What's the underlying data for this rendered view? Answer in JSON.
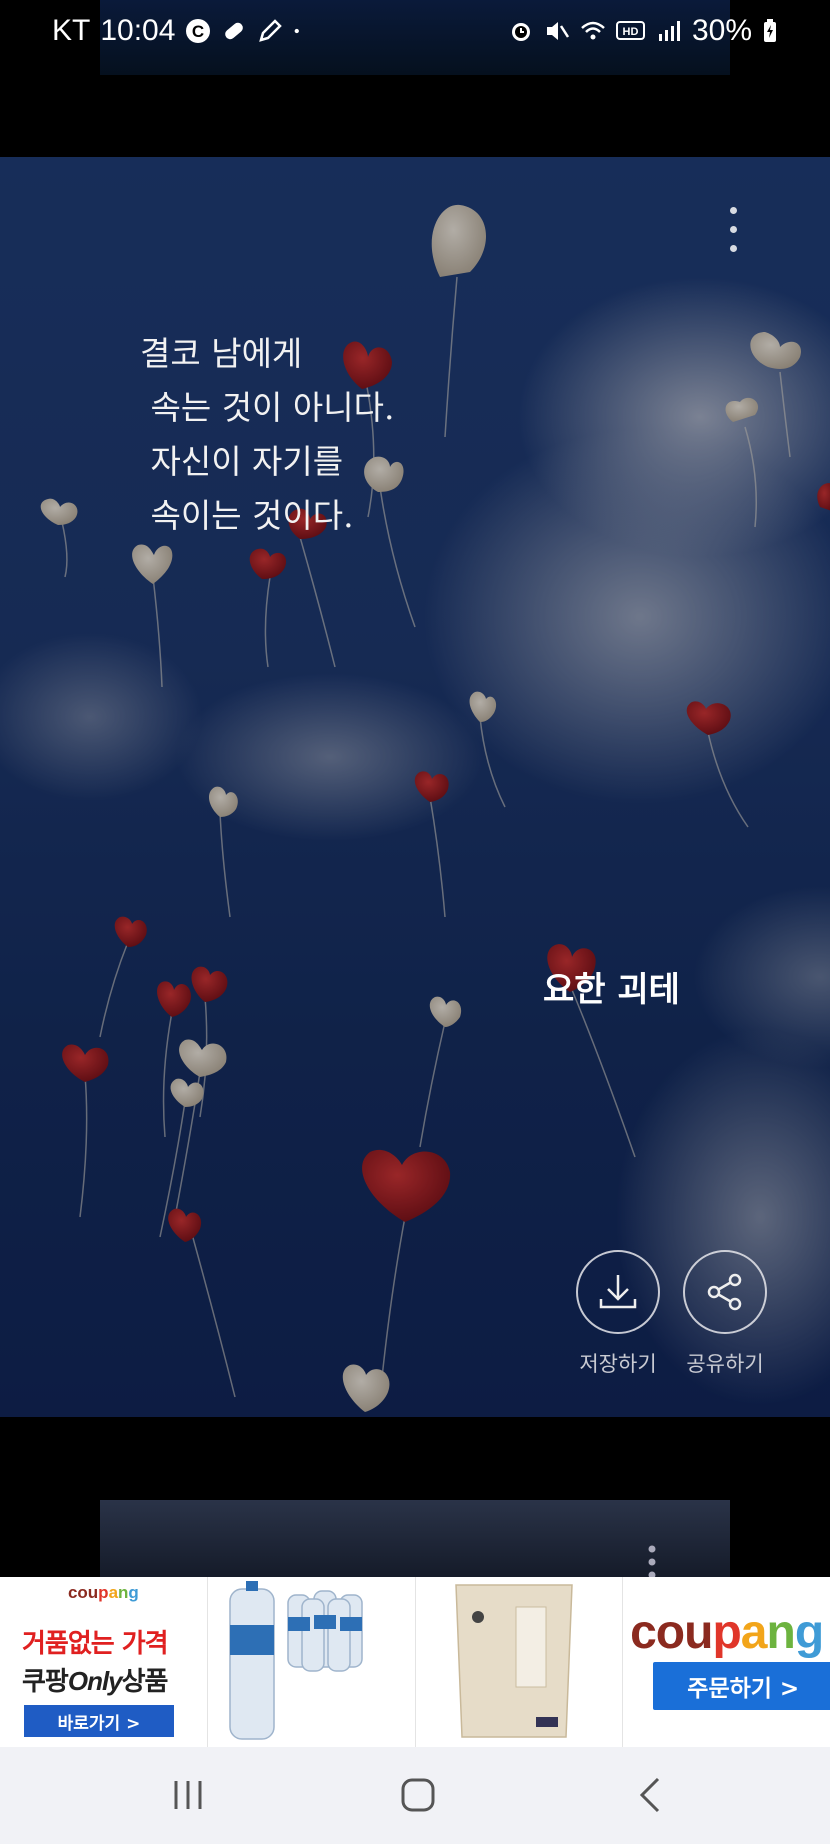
{
  "status_bar": {
    "carrier": "KT",
    "time": "10:04",
    "battery": "30%",
    "left_icons": [
      "c-circle-icon",
      "pill-icon",
      "pen-icon",
      "dot-icon"
    ],
    "right_icons": [
      "alarm-icon",
      "mute-icon",
      "wifi-icon",
      "hd-icon",
      "signal-icon",
      "battery-icon"
    ]
  },
  "card": {
    "quote_lines": [
      "결코 남에게",
      " 속는 것이 아니다.",
      " 자신이 자기를",
      " 속이는 것이다."
    ],
    "author": "요한 괴테",
    "actions": {
      "save_label": "저장하기",
      "share_label": "공유하기"
    },
    "background_icon": "balloons-sky-image"
  },
  "ad_banner": {
    "brand": "coupang",
    "tile1": {
      "line1": "거품없는 가격",
      "line2_prefix": "쿠팡",
      "line2_emph": "Only",
      "line2_suffix": "상품",
      "button": "바로가기 >"
    },
    "tile2_icon": "water-bottles-image",
    "tile3_icon": "rice-bag-image",
    "tile4": {
      "button": "주문하기 >"
    },
    "brand_colors": [
      "#8b2a1f",
      "#e0362a",
      "#f2a51a",
      "#6db33f",
      "#3f9bd6"
    ]
  },
  "nav_bar": {
    "icons": [
      "recent-apps-icon",
      "home-icon",
      "back-icon"
    ]
  }
}
